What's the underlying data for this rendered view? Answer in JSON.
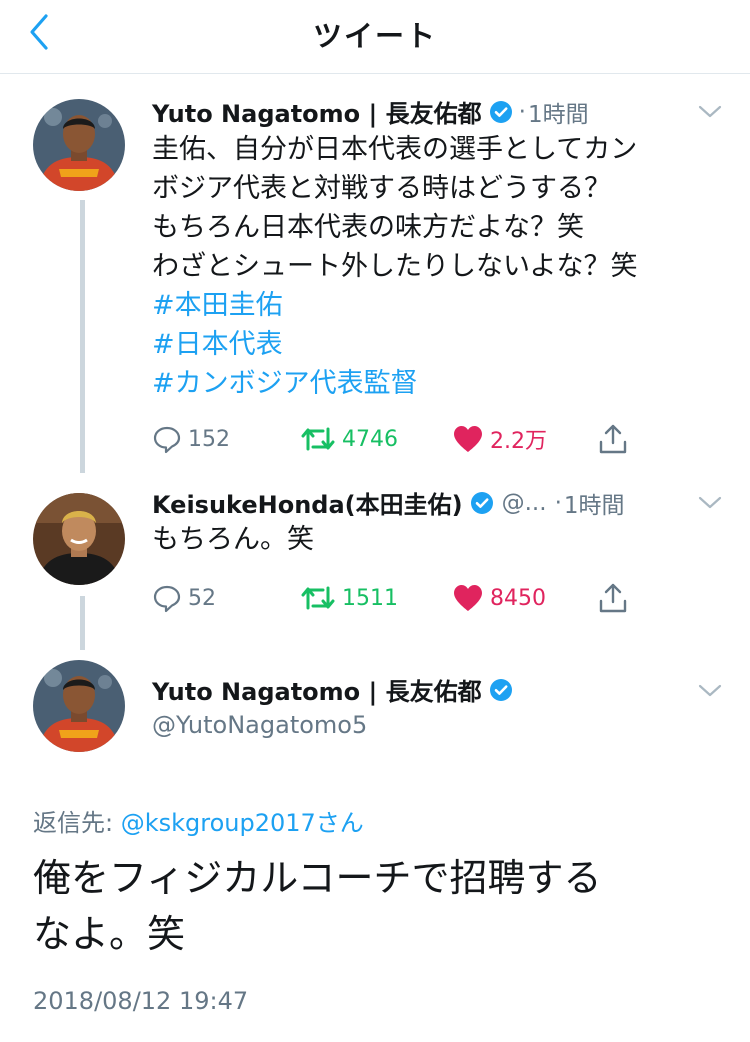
{
  "header": {
    "title": "ツイート",
    "back_icon": "chevron-left-icon",
    "accent": "#1da1f2"
  },
  "tweets": [
    {
      "author": "Yuto Nagatomo | 長友佑都",
      "verified": true,
      "separator": "·",
      "time": "1時間",
      "lines": [
        "圭佑、自分が日本代表の選手としてカン",
        "ボジア代表と対戦する時はどうする？",
        "もちろん日本代表の味方だよな？笑",
        "わざとシュート外したりしないよな？笑"
      ],
      "hashtags": [
        "#本田圭佑",
        "#日本代表",
        "#カンボジア代表監督"
      ],
      "replies": "152",
      "retweets": "4746",
      "likes": "2.2万"
    },
    {
      "author": "KeisukeHonda(本田圭佑)",
      "verified": true,
      "handle_truncated": "@...",
      "separator": "·",
      "time": "1時間",
      "lines": [
        "もちろん。笑"
      ],
      "replies": "52",
      "retweets": "1511",
      "likes": "8450"
    }
  ],
  "focused": {
    "author": "Yuto Nagatomo | 長友佑都",
    "verified": true,
    "handle": "@YutoNagatomo5",
    "reply_prefix": "返信先: ",
    "reply_mention": "@kskgroup2017さん",
    "text_line1": "俺をフィジカルコーチで招聘する",
    "text_line2": "なよ。笑",
    "timestamp": "2018/08/12 19:47"
  },
  "colors": {
    "link": "#1da1f2",
    "retweet": "#17bf63",
    "like": "#e0245e",
    "secondary": "#657786",
    "verified": "#1da1f2"
  }
}
